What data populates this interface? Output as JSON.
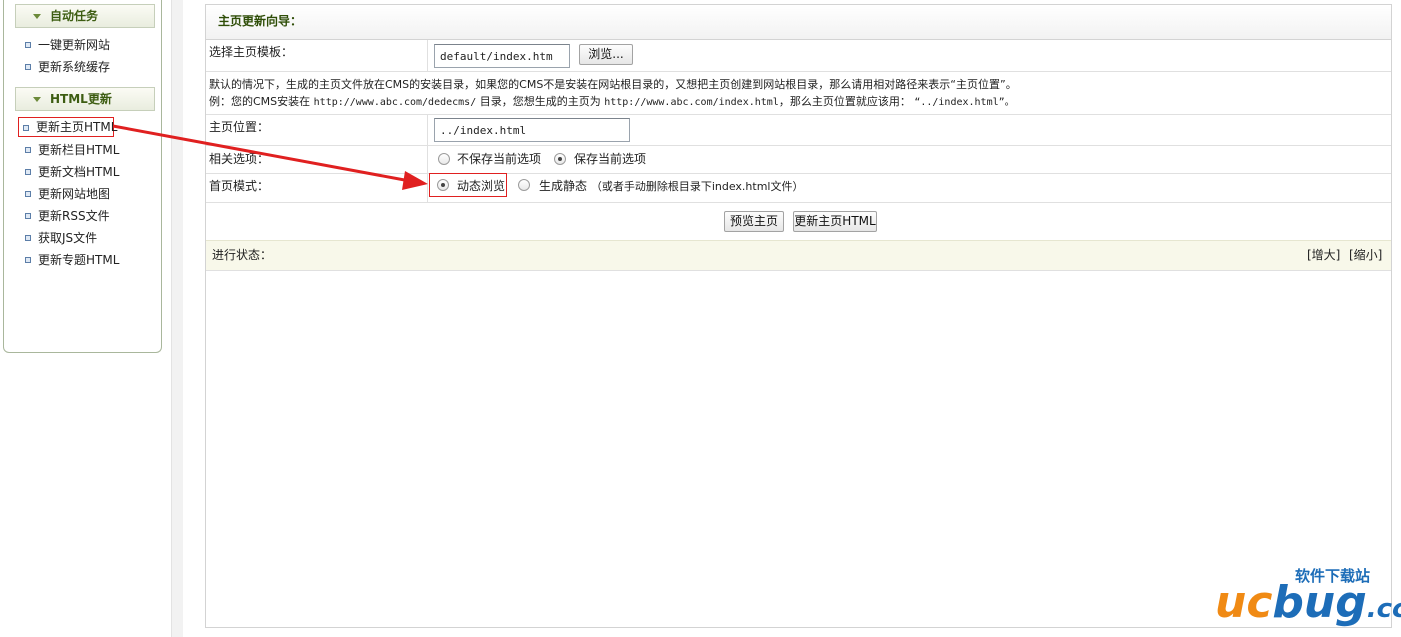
{
  "sidebar": {
    "auto_tasks": {
      "title": "自动任务",
      "items": [
        {
          "label": "一键更新网站"
        },
        {
          "label": "更新系统缓存"
        }
      ]
    },
    "html_update": {
      "title": "HTML更新",
      "items": [
        {
          "label": "更新主页HTML"
        },
        {
          "label": "更新栏目HTML"
        },
        {
          "label": "更新文档HTML"
        },
        {
          "label": "更新网站地图"
        },
        {
          "label": "更新RSS文件"
        },
        {
          "label": "获取JS文件"
        },
        {
          "label": "更新专题HTML"
        }
      ]
    }
  },
  "panel": {
    "title": "主页更新向导：",
    "template": {
      "label": "选择主页模板：",
      "value": "default/index.htm",
      "browse_label": "浏览..."
    },
    "hint": {
      "line1": "默认的情况下，生成的主页文件放在CMS的安装目录，如果您的CMS不是安装在网站根目录的，又想把主页创建到网站根目录，那么请用相对路径来表示“主页位置”。",
      "line2_prefix": "例：您的CMS安装在",
      "line2_url1": "http://www.abc.com/dedecms/",
      "line2_mid": "目录，您想生成的主页为",
      "line2_url2": "http://www.abc.com/index.html",
      "line2_suffix": "，那么主页位置就应该用：",
      "line2_path": "“../index.html”。"
    },
    "location": {
      "label": "主页位置：",
      "value": "../index.html"
    },
    "options": {
      "label": "相关选项：",
      "opt1": "不保存当前选项",
      "opt2": "保存当前选项",
      "selected": "保存当前选项"
    },
    "mode": {
      "label": "首页模式：",
      "opt1": "动态浏览",
      "opt2": "生成静态",
      "opt2_note": "（或者手动删除根目录下index.html文件）",
      "selected": "动态浏览"
    },
    "actions": {
      "preview_label": "预览主页",
      "update_label": "更新主页HTML"
    },
    "status": {
      "label": "进行状态：",
      "enlarge_label": "[增大]",
      "shrink_label": "[缩小]"
    }
  },
  "watermark": {
    "top": "软件下载站",
    "brand_a": "uc",
    "brand_b": "bug",
    "brand_c": ".cc"
  },
  "colors": {
    "annotation_red": "#e02020",
    "sidebar_heading": "#3d5d12",
    "status_bg": "#f8f8ea",
    "watermark_orange": "#f08a14",
    "watermark_blue": "#1d6db8"
  }
}
